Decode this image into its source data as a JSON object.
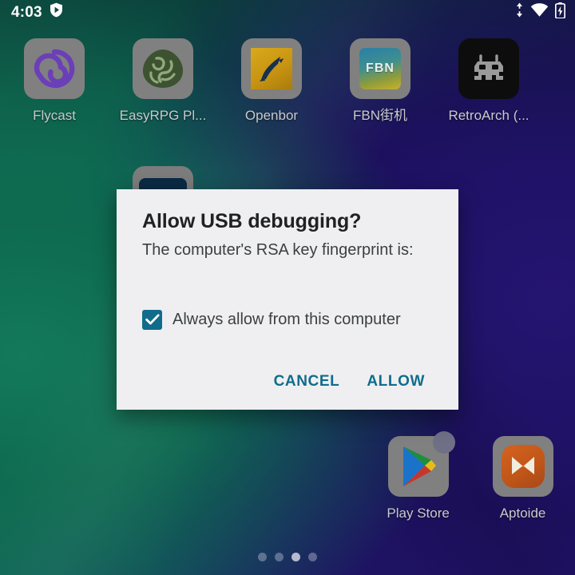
{
  "status_bar": {
    "clock": "4:03",
    "left_icons": [
      {
        "name": "vpn-shield-icon",
        "glyph": "shield-play"
      }
    ],
    "right_icons": [
      {
        "name": "data-transfer-icon",
        "glyph": "up-down-arrows"
      },
      {
        "name": "wifi-icon",
        "glyph": "wifi"
      },
      {
        "name": "battery-charging-icon",
        "glyph": "battery-bolt"
      }
    ]
  },
  "home_screen": {
    "rows": [
      {
        "id": "app-row-1",
        "apps": [
          {
            "label": "Flycast",
            "icon": "flycast-icon"
          },
          {
            "label": "EasyRPG Pl...",
            "icon": "easyrpg-player-icon"
          },
          {
            "label": "Openbor",
            "icon": "openbor-icon"
          },
          {
            "label": "FBN街机",
            "icon": "fbn-arcade-icon",
            "icon_text": "FBN"
          },
          {
            "label": "RetroArch (...",
            "icon": "retroarch-icon"
          }
        ]
      },
      {
        "id": "app-row-4",
        "apps": [
          {
            "label": "Play Store",
            "icon": "play-store-icon",
            "badge": true
          },
          {
            "label": "Aptoide",
            "icon": "aptoide-icon"
          }
        ]
      }
    ],
    "page_indicator": {
      "count": 4,
      "active_index": 2
    }
  },
  "dialog": {
    "title": "Allow USB debugging?",
    "message": "The computer's RSA key fingerprint is:",
    "fingerprint": "",
    "checkbox": {
      "label": "Always allow from this computer",
      "checked": true
    },
    "buttons": {
      "cancel": "CANCEL",
      "allow": "ALLOW"
    }
  },
  "colors": {
    "accent": "#106c8c",
    "dialog_background": "#efeff1",
    "title_text": "#202124",
    "body_text": "#3c4043",
    "app_label_text": "#c8cacc",
    "wallpaper_green": "#0e6b50",
    "wallpaper_indigo": "#241571"
  }
}
